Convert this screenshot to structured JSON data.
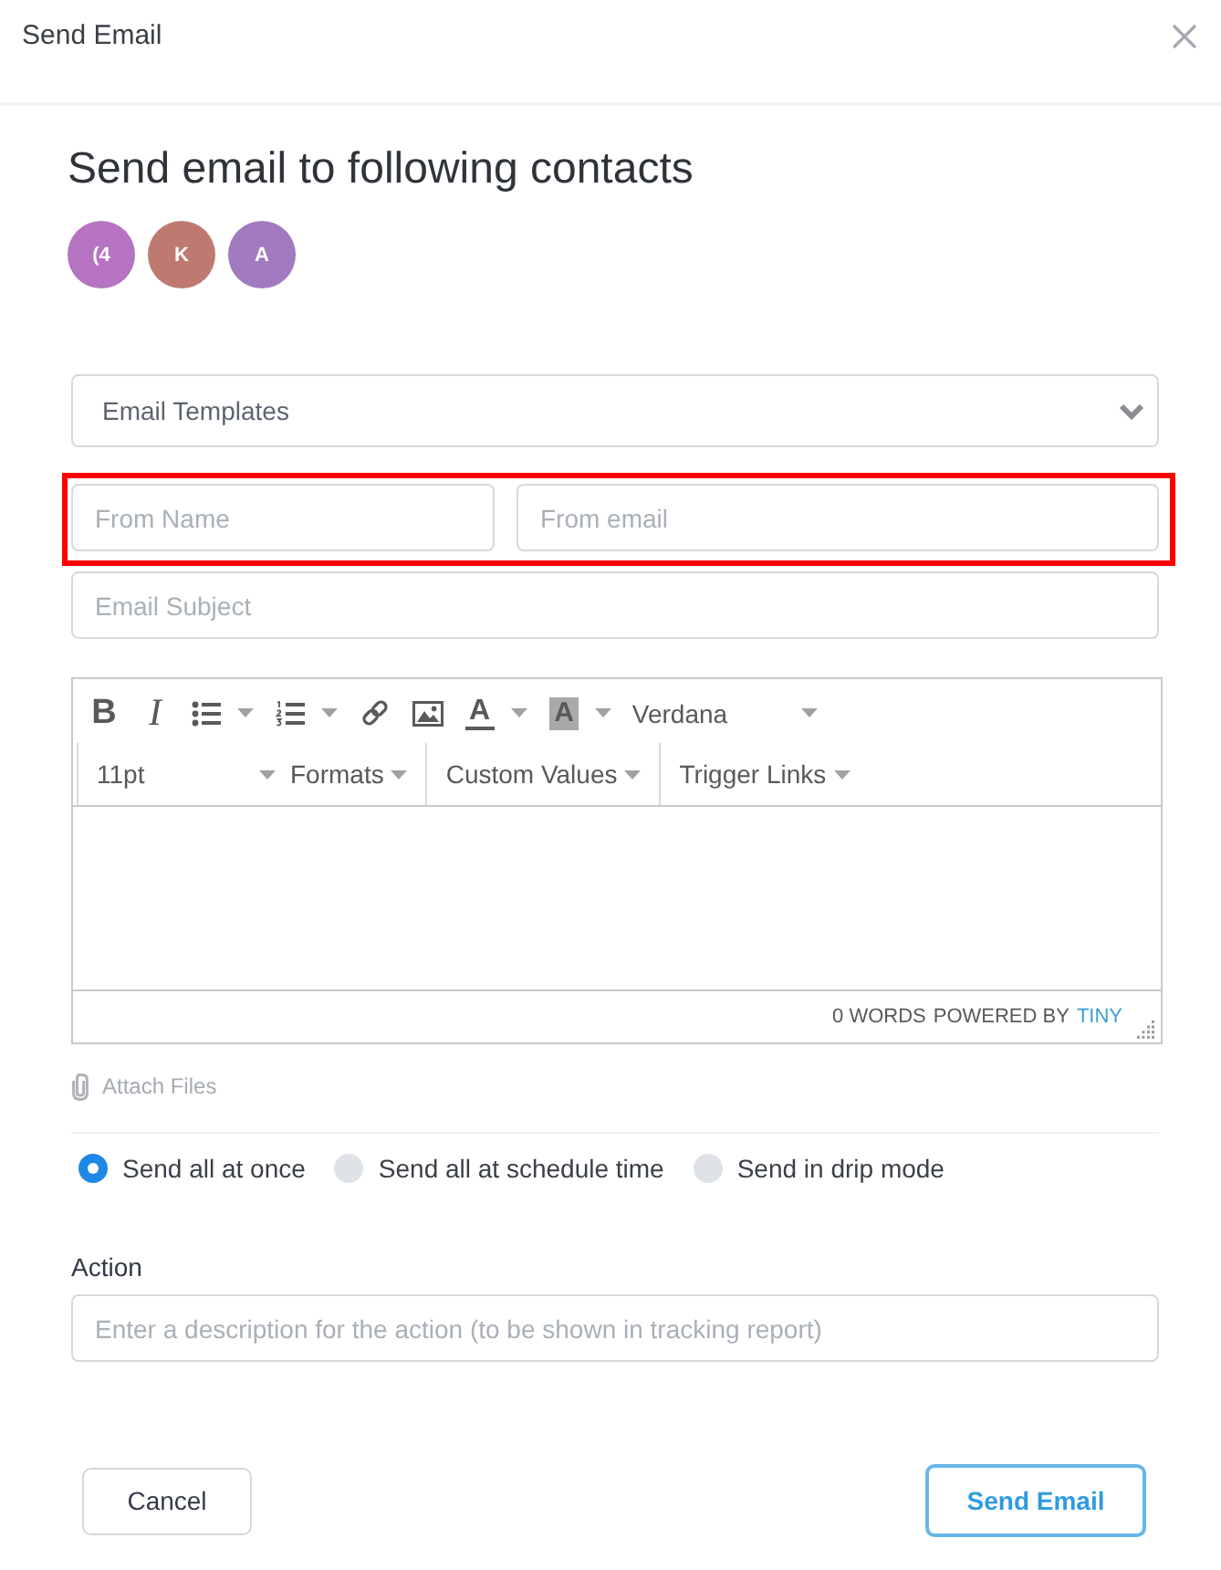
{
  "dialog": {
    "title": "Send Email"
  },
  "heading": "Send email to following contacts",
  "contacts": [
    {
      "initials": "(4",
      "color": "#b673c1"
    },
    {
      "initials": "K",
      "color": "#be7a71"
    },
    {
      "initials": "A",
      "color": "#a17ac0"
    }
  ],
  "template_select": {
    "placeholder": "Email Templates"
  },
  "sender": {
    "highlighted": true,
    "name_field": {
      "placeholder": "From Name"
    },
    "email_field": {
      "placeholder": "From email"
    }
  },
  "subject_field": {
    "placeholder": "Email Subject"
  },
  "editor": {
    "toolbar": [
      {
        "groups": [
          [
            {
              "kind": "bold",
              "label": "B",
              "dropdown": false
            },
            {
              "kind": "italic",
              "label": "I",
              "dropdown": false
            },
            {
              "kind": "bullets",
              "dropdown": true
            },
            {
              "kind": "numbers",
              "dropdown": true
            },
            {
              "kind": "link",
              "dropdown": false
            },
            {
              "kind": "image",
              "dropdown": false
            },
            {
              "kind": "text-color",
              "label": "A",
              "dropdown": true
            },
            {
              "kind": "background-color",
              "label": "A",
              "dropdown": true
            },
            {
              "kind": "select",
              "label": "Verdana",
              "dropdown": true
            }
          ]
        ]
      },
      {
        "groups": [
          [
            {
              "kind": "select",
              "label": "11pt",
              "dropdown": true
            },
            {
              "kind": "menu",
              "label": "Formats",
              "dropdown": true
            }
          ],
          [
            {
              "kind": "menu",
              "label": "Custom Values",
              "dropdown": true
            }
          ],
          [
            {
              "kind": "menu",
              "label": "Trigger Links",
              "dropdown": true
            }
          ]
        ]
      }
    ],
    "word_count": "0 WORDS",
    "powered_by": "POWERED BY",
    "brand_link": "TINY"
  },
  "attach": {
    "label": "Attach Files"
  },
  "send_modes": [
    {
      "label": "Send all at once",
      "selected": true
    },
    {
      "label": "Send all at schedule time",
      "selected": false
    },
    {
      "label": "Send in drip mode",
      "selected": false
    }
  ],
  "action": {
    "label": "Action",
    "placeholder": "Enter a description for the action (to be shown in tracking report)"
  },
  "buttons": [
    {
      "kind": "secondary",
      "label": "Cancel"
    },
    {
      "kind": "primary",
      "label": "Send Email"
    }
  ]
}
